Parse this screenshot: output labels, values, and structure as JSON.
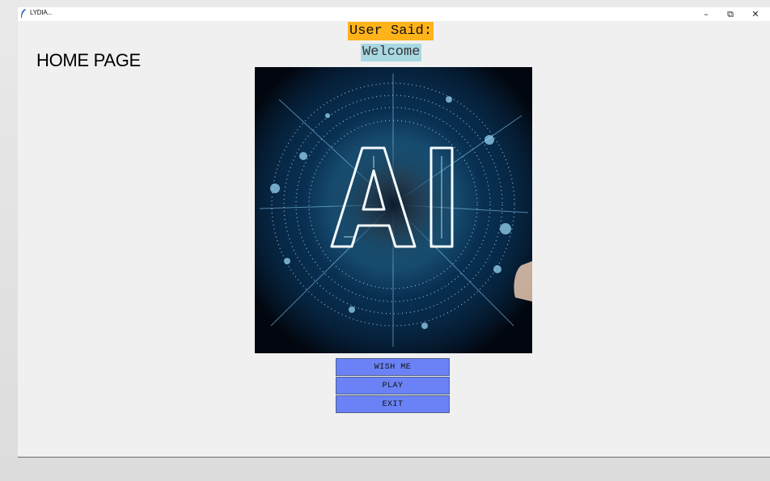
{
  "window": {
    "title": "LYDIA...",
    "controls": {
      "minimize": "–",
      "maximize": "⧉",
      "close": "✕"
    }
  },
  "page": {
    "title": "HOME PAGE"
  },
  "status": {
    "label": "User Said:",
    "speech": "Welcome",
    "label_color": "#ffb31a",
    "speech_color": "#a9d8e3"
  },
  "hero_image": {
    "text": "AI",
    "description_icon": "ai-circuit-image"
  },
  "buttons": [
    {
      "label": "WISH ME"
    },
    {
      "label": "PLAY"
    },
    {
      "label": "EXIT"
    }
  ],
  "colors": {
    "button_bg": "#6a82f6",
    "window_bg": "#f0f0f0"
  }
}
